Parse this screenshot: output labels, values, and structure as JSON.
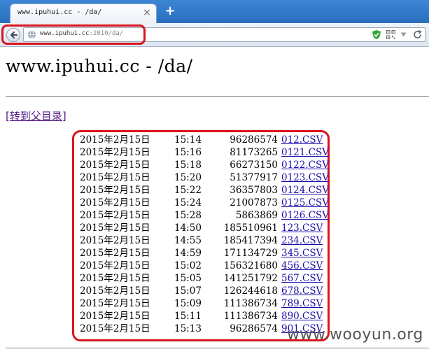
{
  "browser": {
    "tab_title": "www.ipuhui.cc - /da/",
    "tab_close": "×",
    "new_tab": "+",
    "url_host": "www.ipuhui.cc",
    "url_rest": ":2010/da/"
  },
  "page": {
    "title": "www.ipuhui.cc - /da/",
    "parent_link": "[转到父目录]"
  },
  "files": [
    {
      "date": "2015年2月15日",
      "time": "15:14",
      "size": "96286574",
      "name": "012.CSV"
    },
    {
      "date": "2015年2月15日",
      "time": "15:16",
      "size": "81173265",
      "name": "0121.CSV"
    },
    {
      "date": "2015年2月15日",
      "time": "15:18",
      "size": "66273150",
      "name": "0122.CSV"
    },
    {
      "date": "2015年2月15日",
      "time": "15:20",
      "size": "51377917",
      "name": "0123.CSV"
    },
    {
      "date": "2015年2月15日",
      "time": "15:22",
      "size": "36357803",
      "name": "0124.CSV"
    },
    {
      "date": "2015年2月15日",
      "time": "15:24",
      "size": "21007873",
      "name": "0125.CSV"
    },
    {
      "date": "2015年2月15日",
      "time": "15:28",
      "size": "5863869",
      "name": "0126.CSV"
    },
    {
      "date": "2015年2月15日",
      "time": "14:50",
      "size": "185510961",
      "name": "123.CSV"
    },
    {
      "date": "2015年2月15日",
      "time": "14:55",
      "size": "185417394",
      "name": "234.CSV"
    },
    {
      "date": "2015年2月15日",
      "time": "14:59",
      "size": "171134729",
      "name": "345.CSV"
    },
    {
      "date": "2015年2月15日",
      "time": "15:02",
      "size": "156321680",
      "name": "456.CSV"
    },
    {
      "date": "2015年2月15日",
      "time": "15:05",
      "size": "141251792",
      "name": "567.CSV"
    },
    {
      "date": "2015年2月15日",
      "time": "15:07",
      "size": "126244618",
      "name": "678.CSV"
    },
    {
      "date": "2015年2月15日",
      "time": "15:09",
      "size": "111386734",
      "name": "789.CSV"
    },
    {
      "date": "2015年2月15日",
      "time": "15:11",
      "size": "111386734",
      "name": "890.CSV"
    },
    {
      "date": "2015年2月15日",
      "time": "15:13",
      "size": "96286574",
      "name": "901.CSV"
    }
  ],
  "watermark": "www.wooyun.org",
  "colors": {
    "highlight": "#d9141e",
    "link": "#1a0dab",
    "visited_link": "#551a8b",
    "tab_strip": "#2a6fbe"
  },
  "icons": [
    "back-arrow-icon",
    "globe-icon",
    "shield-icon",
    "qr-code-icon",
    "dropdown-arrow-icon",
    "reload-icon",
    "close-icon",
    "plus-icon"
  ]
}
